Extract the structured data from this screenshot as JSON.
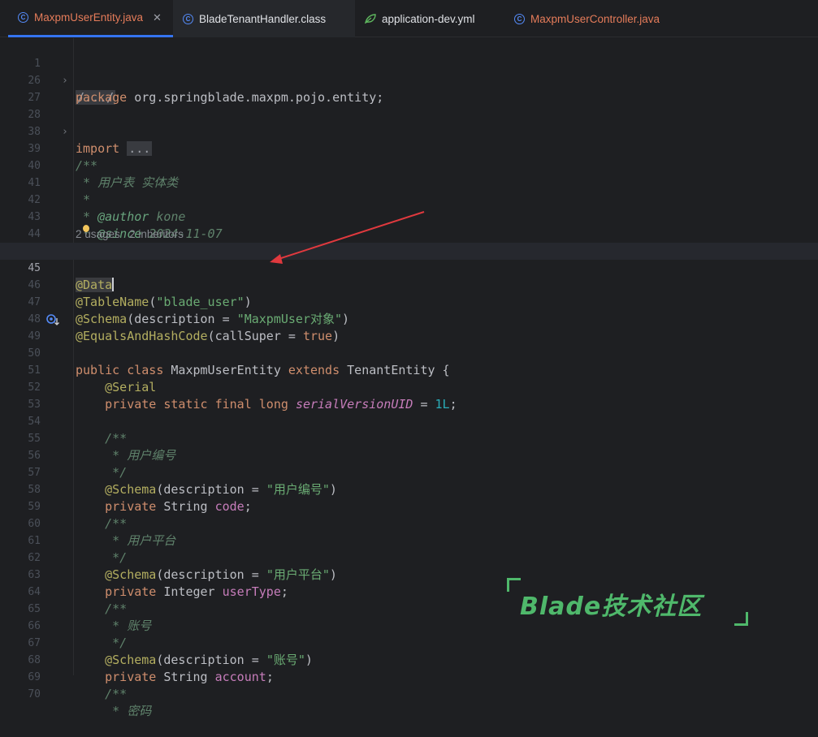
{
  "tabs": [
    {
      "label": "MaxpmUserEntity.java",
      "color": "#e57c5a",
      "icon": "java-class-icon",
      "active": true
    },
    {
      "label": "BladeTenantHandler.class",
      "color": "#dfe1e5",
      "icon": "java-class-icon"
    },
    {
      "label": "application-dev.yml",
      "color": "#dfe1e5",
      "icon": "yaml-leaf-icon"
    },
    {
      "label": "MaxpmUserController.java",
      "color": "#e57c5a",
      "icon": "java-class-icon"
    }
  ],
  "hints": {
    "usages": "2 usages",
    "inheritors": "2 inheritors"
  },
  "lines": {
    "l1": {
      "n": "1",
      "fold": "/.../"
    },
    "l26": {
      "n": "26",
      "kw": "package",
      "rest": " org.springblade.maxpm.pojo.entity;"
    },
    "l27": {
      "n": "27"
    },
    "l28": {
      "n": "28",
      "kw": "import",
      "fold": "..."
    },
    "l38": {
      "n": "38"
    },
    "l39": {
      "n": "39",
      "doc": "/**"
    },
    "l40": {
      "n": "40",
      "doc": " * 用户表 实体类"
    },
    "l41": {
      "n": "41",
      "doc": " *"
    },
    "l42": {
      "n": "42",
      "doc": " * ",
      "tag": "@author",
      "val": " kone"
    },
    "l43": {
      "n": "43",
      "doc": " * ",
      "tag": "@since",
      "val": " 2024-11-07"
    },
    "l44": {
      "n": "44",
      "doc": " */"
    },
    "l45": {
      "n": "45",
      "ann": "@Data"
    },
    "l46": {
      "n": "46",
      "ann": "@TableName",
      "p1": "(",
      "str": "\"blade_user\"",
      "p2": ")"
    },
    "l47": {
      "n": "47",
      "ann": "@Schema",
      "p1": "(description = ",
      "str": "\"MaxpmUser对象\"",
      "p2": ")"
    },
    "l48": {
      "n": "48",
      "ann": "@EqualsAndHashCode",
      "p1": "(callSuper = ",
      "kw": "true",
      "p2": ")"
    },
    "l49": {
      "n": "49",
      "kw1": "public class",
      "name": " MaxpmUserEntity ",
      "kw2": "extends",
      "rest": " TenantEntity {"
    },
    "l50": {
      "n": "50"
    },
    "l51": {
      "n": "51",
      "ann": "    @Serial"
    },
    "l52": {
      "n": "52",
      "kw": "    private static final long ",
      "fld": "serialVersionUID",
      "p1": " = ",
      "num": "1L",
      "p2": ";"
    },
    "l53": {
      "n": "53"
    },
    "l54": {
      "n": "54",
      "doc": "    /**"
    },
    "l55": {
      "n": "55",
      "doc": "     * 用户编号"
    },
    "l56": {
      "n": "56",
      "doc": "     */"
    },
    "l57": {
      "n": "57",
      "ann": "    @Schema",
      "p1": "(description = ",
      "str": "\"用户编号\"",
      "p2": ")"
    },
    "l58": {
      "n": "58",
      "kw": "    private ",
      "type": "String ",
      "fld": "code",
      "p2": ";"
    },
    "l59": {
      "n": "59",
      "doc": "    /**"
    },
    "l60": {
      "n": "60",
      "doc": "     * 用户平台"
    },
    "l61": {
      "n": "61",
      "doc": "     */"
    },
    "l62": {
      "n": "62",
      "ann": "    @Schema",
      "p1": "(description = ",
      "str": "\"用户平台\"",
      "p2": ")"
    },
    "l63": {
      "n": "63",
      "kw": "    private ",
      "type": "Integer ",
      "fld": "userType",
      "p2": ";"
    },
    "l64": {
      "n": "64",
      "doc": "    /**"
    },
    "l65": {
      "n": "65",
      "doc": "     * 账号"
    },
    "l66": {
      "n": "66",
      "doc": "     */"
    },
    "l67": {
      "n": "67",
      "ann": "    @Schema",
      "p1": "(description = ",
      "str": "\"账号\"",
      "p2": ")"
    },
    "l68": {
      "n": "68",
      "kw": "    private ",
      "type": "String ",
      "fld": "account",
      "p2": ";"
    },
    "l69": {
      "n": "69",
      "doc": "    /**"
    },
    "l70": {
      "n": "70",
      "doc": "     * 密码"
    }
  },
  "watermark": "Blade技术社区",
  "colors": {
    "accent": "#3574f0",
    "annotation": "#b3ae60",
    "keyword": "#cf8e6d",
    "string": "#6aab73",
    "arrow": "#e0393e",
    "watermark": "#4fb86b"
  }
}
